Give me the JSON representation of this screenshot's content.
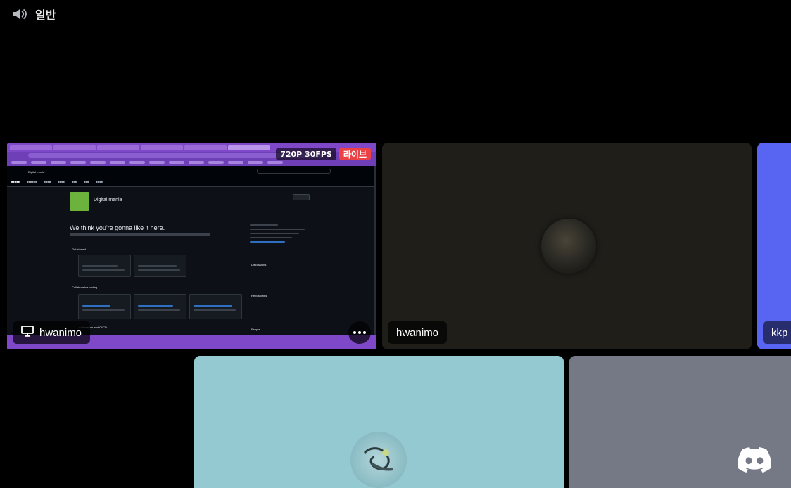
{
  "header": {
    "channel_name": "일반",
    "icon": "speaker-icon"
  },
  "tiles": {
    "screen_share": {
      "user": "hwanimo",
      "quality": "720P 30FPS",
      "live_label": "라이브",
      "user_icon": "monitor-icon",
      "content": {
        "org_name": "Digital mania",
        "headline": "We think you're gonna like it here.",
        "sections": [
          "Get started",
          "Collaborative coding",
          "Automation and CI/CD"
        ],
        "sidebar_sections": [
          "Discussions",
          "Repositories",
          "People"
        ]
      }
    },
    "camera_hwanimo": {
      "user": "hwanimo"
    },
    "kkp": {
      "user": "kkp"
    }
  },
  "colors": {
    "background": "#000000",
    "blurple": "#5865f2",
    "live_red": "#ed4245",
    "cyan_tile": "#94c9d2",
    "gray_tile": "#747985",
    "dark_tile": "#1f1e19"
  }
}
